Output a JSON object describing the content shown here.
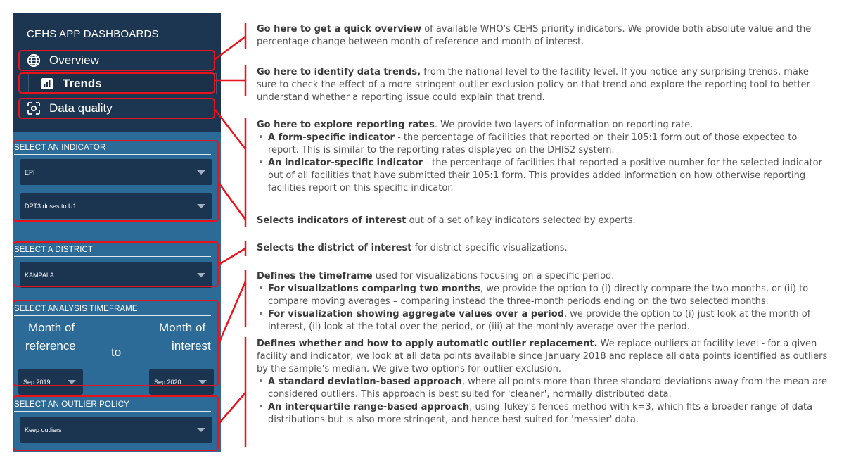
{
  "sidebar": {
    "title": "CEHS APP DASHBOARDS",
    "nav": [
      {
        "label": "Overview",
        "icon": "globe-icon"
      },
      {
        "label": "Trends",
        "icon": "bar-chart-icon"
      },
      {
        "label": "Data quality",
        "icon": "focus-scan-icon"
      }
    ],
    "indicator": {
      "label": "SELECT AN INDICATOR",
      "group_value": "EPI",
      "indicator_value": "DPT3 doses to U1"
    },
    "district": {
      "label": "SELECT A DISTRICT",
      "value": "KAMPALA"
    },
    "timeframe": {
      "label": "SELECT ANALYSIS TIMEFRAME",
      "ref_line1": "Month of",
      "ref_line2": "reference",
      "to": "to",
      "int_line1": "Month of",
      "int_line2": "interest",
      "ref_value": "Sep 2019",
      "int_value": "Sep 2020"
    },
    "outlier": {
      "label": "SELECT AN OUTLIER POLICY",
      "value": "Keep outliers"
    }
  },
  "annotation_color": "#e8131b",
  "descriptions": {
    "overview": {
      "bold": "Go here to get a quick overview",
      "text": " of available WHO's CEHS priority indicators. We provide both absolute value and the percentage change between month of reference and month of interest."
    },
    "trends": {
      "bold": "Go here to identify data trends,",
      "text": " from the national level to the facility level. If you notice any surprising trends, make sure to check the effect of a more stringent outlier exclusion policy on that trend and explore the reporting tool to better understand whether a reporting issue could explain that trend."
    },
    "quality": {
      "bold": "Go here to explore reporting rates",
      "text": ". We provide two layers of information on reporting rate.",
      "bullets": [
        {
          "bold": "A form-specific indicator",
          "text": " - the percentage of facilities that reported on their 105:1 form out of those expected to report. This is similar to the reporting rates displayed on the DHIS2 system."
        },
        {
          "bold": "An indicator-specific indicator",
          "text": " - the percentage of facilities that reported a positive number for the selected indicator out of all facilities that have submitted their 105:1 form. This provides added information on how otherwise reporting facilities report on this specific indicator."
        }
      ]
    },
    "indicator": {
      "bold": "Selects indicators of interest",
      "text": " out of a set of key indicators selected by experts."
    },
    "district": {
      "bold": "Selects the district of interest",
      "text": " for district-specific visualizations."
    },
    "timeframe": {
      "bold": "Defines the timeframe",
      "text": " used for visualizations focusing on a specific period.",
      "bullets": [
        {
          "bold": "For visualizations comparing two months",
          "text": ", we provide the option to (i) directly compare the two months, or (ii) to compare moving averages – comparing instead the three-month periods ending on the two selected months."
        },
        {
          "bold": "For visualization showing aggregate values over a period",
          "text": ", we provide the option to (i) just look at the month of interest, (ii) look at the total over the period, or (iii) at the monthly average over the period."
        }
      ]
    },
    "outlier": {
      "bold": "Defines whether and how to apply automatic outlier replacement.",
      "text": " We replace outliers at facility level - for a given facility and indicator, we look at all data points available since January 2018 and replace all data points identified as outliers by the sample's median. We give two options for outlier exclusion.",
      "bullets": [
        {
          "bold": "A standard deviation-based approach",
          "text": ", where all points more than three standard deviations away from the mean are considered outliers. This approach is best suited for 'cleaner', normally distributed data."
        },
        {
          "bold": "An interquartile range-based approach",
          "text": ", using Tukey's fences method with k=3, which fits a broader range of data distributions but is also more stringent, and hence best suited for 'messier' data."
        }
      ]
    }
  }
}
